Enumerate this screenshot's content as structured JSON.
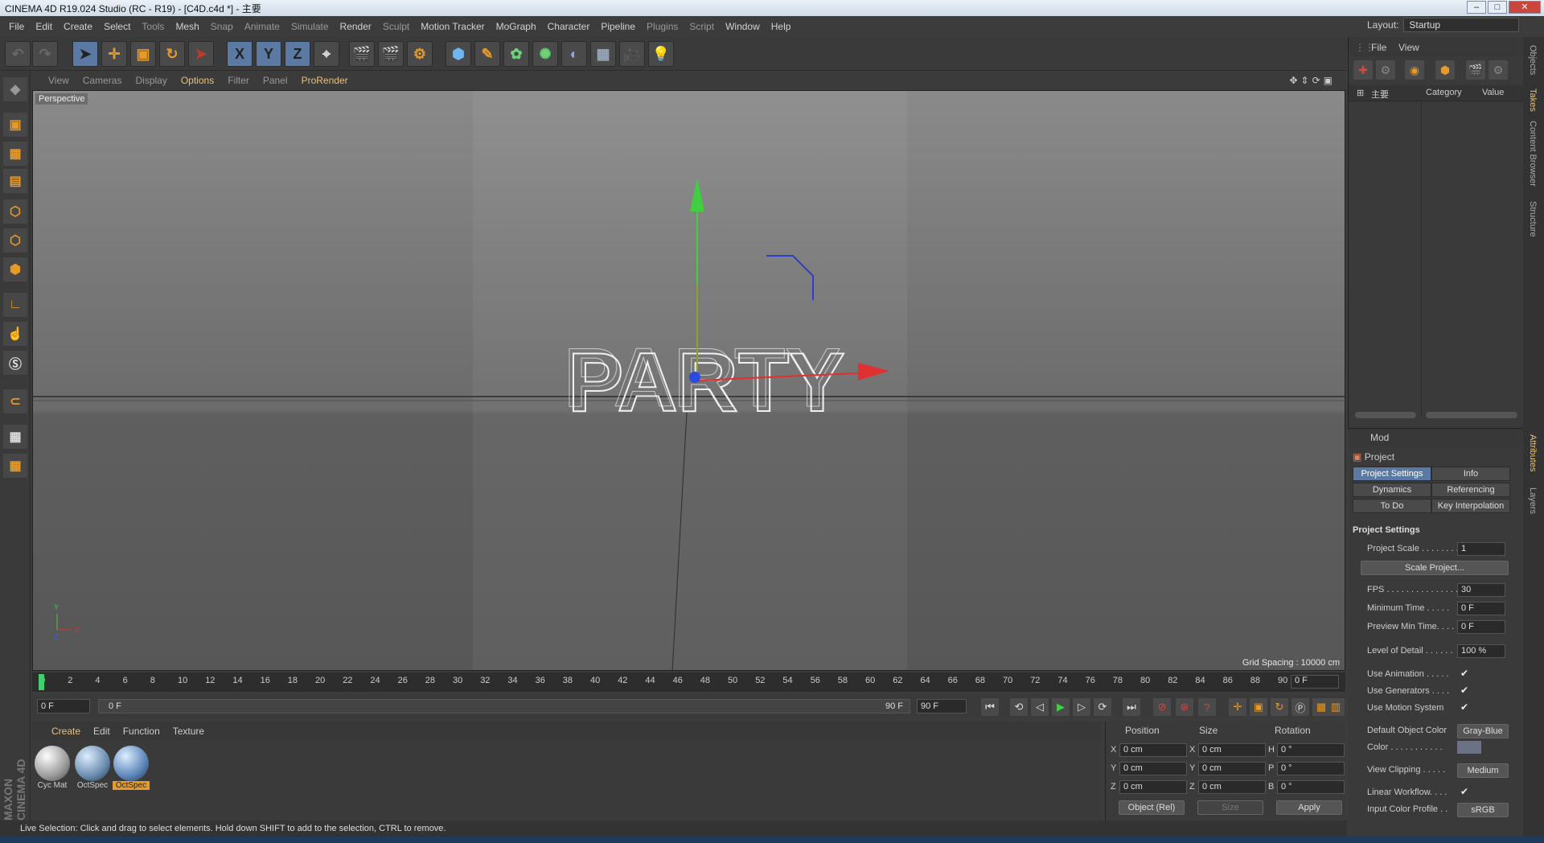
{
  "window": {
    "title": "CINEMA 4D R19.024 Studio (RC - R19) - [C4D.c4d *] - 主要",
    "buttons": [
      "–",
      "□",
      "✕"
    ]
  },
  "menu": [
    "File",
    "Edit",
    "Create",
    "Select",
    "Tools",
    "Mesh",
    "Snap",
    "Animate",
    "Simulate",
    "Render",
    "Sculpt",
    "Motion Tracker",
    "MoGraph",
    "Character",
    "Pipeline",
    "Plugins",
    "Script",
    "Window",
    "Help"
  ],
  "layout": {
    "label": "Layout:",
    "value": "Startup"
  },
  "viewport": {
    "menu": [
      "View",
      "Cameras",
      "Display",
      "Options",
      "Filter",
      "Panel",
      "ProRender"
    ],
    "label": "Perspective",
    "object_text": "PARTY",
    "grid_spacing": "Grid Spacing : 10000 cm",
    "axis": {
      "y": "Y",
      "x": "X",
      "z": "Z"
    }
  },
  "timeline": {
    "ticks": [
      "0",
      "2",
      "4",
      "6",
      "8",
      "10",
      "12",
      "14",
      "16",
      "18",
      "20",
      "22",
      "24",
      "26",
      "28",
      "30",
      "32",
      "34",
      "36",
      "38",
      "40",
      "42",
      "44",
      "46",
      "48",
      "50",
      "52",
      "54",
      "56",
      "58",
      "60",
      "62",
      "64",
      "66",
      "68",
      "70",
      "72",
      "74",
      "76",
      "78",
      "80",
      "82",
      "84",
      "86",
      "88",
      "90"
    ],
    "current": "0 F"
  },
  "playback": {
    "start": "0 F",
    "range_start": "0 F",
    "range_end": "90 F",
    "end": "90 F"
  },
  "materials": {
    "menu": [
      "Create",
      "Edit",
      "Function",
      "Texture"
    ],
    "items": [
      "Cyc Mat",
      "OctSpec",
      "OctSpec"
    ]
  },
  "coordinates": {
    "headers": [
      "Position",
      "Size",
      "Rotation"
    ],
    "rows": [
      {
        "axis": "X",
        "pos": "0 cm",
        "size_axis": "X",
        "size": "0 cm",
        "rot_axis": "H",
        "rot": "0 °"
      },
      {
        "axis": "Y",
        "pos": "0 cm",
        "size_axis": "Y",
        "size": "0 cm",
        "rot_axis": "P",
        "rot": "0 °"
      },
      {
        "axis": "Z",
        "pos": "0 cm",
        "size_axis": "Z",
        "size": "0 cm",
        "rot_axis": "B",
        "rot": "0 °"
      }
    ],
    "mode": "Object (Rel)",
    "size_mode": "Size",
    "apply": "Apply"
  },
  "status": "Live Selection: Click and drag to select elements. Hold down SHIFT to add to the selection, CTRL to remove.",
  "maxon": "MAXON CINEMA 4D",
  "objects_panel": {
    "menu": [
      "File",
      "View"
    ],
    "columns": [
      "主要",
      "Category",
      "Value"
    ]
  },
  "attributes": {
    "mode": "Mod",
    "object": "Project",
    "tabs": [
      "Project Settings",
      "Info",
      "Dynamics",
      "Referencing",
      "To Do",
      "Key Interpolation"
    ],
    "section": "Project Settings",
    "project_scale": {
      "label": "Project Scale . . . . . . . .",
      "value": "1"
    },
    "scale_button": "Scale Project...",
    "fps": {
      "label": "FPS . . . . . . . . . . . . . . .",
      "value": "30"
    },
    "min_time": {
      "label": "Minimum Time . . . . .",
      "value": "0 F"
    },
    "preview_min": {
      "label": "Preview Min Time. . . .",
      "value": "0 F"
    },
    "lod": {
      "label": "Level of Detail . . . . . .",
      "value": "100 %"
    },
    "use_animation": "Use Animation . . . . .",
    "use_generators": "Use Generators . . . .",
    "use_motion": "Use Motion System",
    "default_color": {
      "label": "Default Object Color",
      "value": "Gray-Blue"
    },
    "color_label": "Color . . . . . . . . . . .",
    "view_clipping": {
      "label": "View Clipping . . . . .",
      "value": "Medium"
    },
    "linear_workflow": "Linear Workflow. . . .",
    "input_profile": {
      "label": "Input Color Profile . .",
      "value": "sRGB"
    }
  },
  "side_tabs": [
    "Objects",
    "Takes",
    "Content Browser",
    "Structure",
    "Attributes",
    "Layers"
  ]
}
